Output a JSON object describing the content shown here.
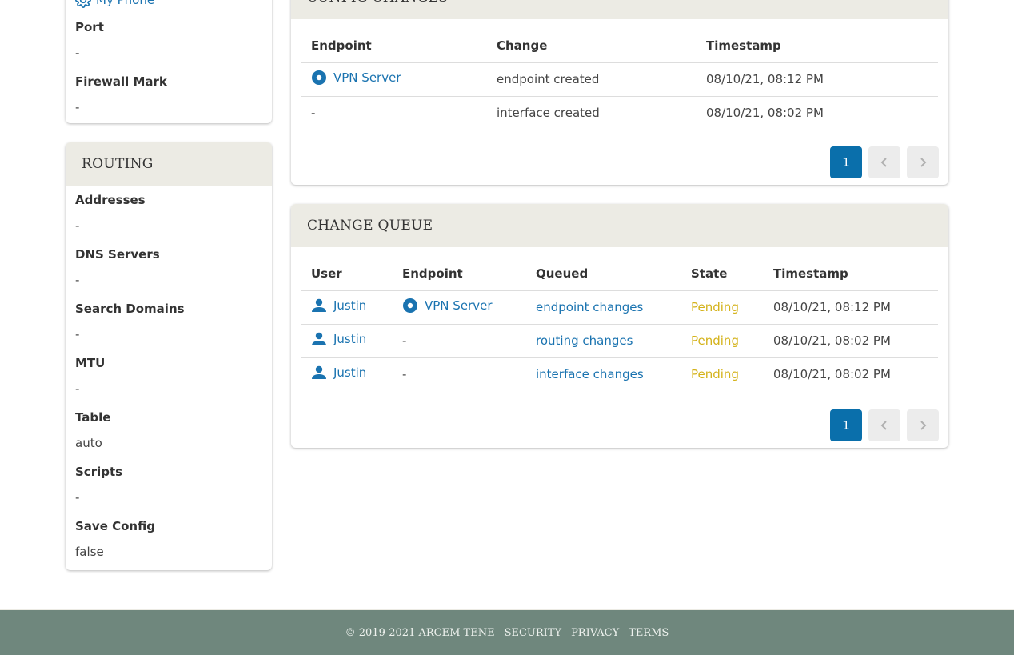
{
  "interface_card": {
    "top_link": {
      "icon": "gear-icon",
      "label": "My Phone"
    },
    "properties": [
      {
        "label": "Port",
        "value": "-"
      },
      {
        "label": "Firewall Mark",
        "value": "-"
      }
    ]
  },
  "routing_card": {
    "title": "ROUTING",
    "properties": [
      {
        "label": "Addresses",
        "value": "-"
      },
      {
        "label": "DNS Servers",
        "value": "-"
      },
      {
        "label": "Search Domains",
        "value": "-"
      },
      {
        "label": "MTU",
        "value": "-"
      },
      {
        "label": "Table",
        "value": "auto"
      },
      {
        "label": "Scripts",
        "value": "-"
      },
      {
        "label": "Save Config",
        "value": "false"
      }
    ]
  },
  "config_changes": {
    "title": "CONFIG CHANGES",
    "columns": [
      "Endpoint",
      "Change",
      "Timestamp"
    ],
    "rows": [
      {
        "endpoint": "VPN Server",
        "endpoint_icon": "endpoint-dot-icon",
        "change": "endpoint created",
        "timestamp": "08/10/21, 08:12 PM"
      },
      {
        "endpoint": "-",
        "change": "interface created",
        "timestamp": "08/10/21, 08:02 PM"
      }
    ],
    "pagination": {
      "current_page": "1",
      "prev_icon": "chevron-left-icon",
      "next_icon": "chevron-right-icon"
    }
  },
  "change_queue": {
    "title": "CHANGE QUEUE",
    "columns": [
      "User",
      "Endpoint",
      "Queued",
      "State",
      "Timestamp"
    ],
    "rows": [
      {
        "user": "Justin",
        "endpoint": "VPN Server",
        "queued": "endpoint changes",
        "state": "Pending",
        "timestamp": "08/10/21, 08:12 PM"
      },
      {
        "user": "Justin",
        "endpoint": "-",
        "queued": "routing changes",
        "state": "Pending",
        "timestamp": "08/10/21, 08:02 PM"
      },
      {
        "user": "Justin",
        "endpoint": "-",
        "queued": "interface changes",
        "state": "Pending",
        "timestamp": "08/10/21, 08:02 PM"
      }
    ],
    "pagination": {
      "current_page": "1"
    }
  },
  "footer": {
    "copyright": "© 2019-2021 ARCEM TENE",
    "links": [
      "SECURITY",
      "PRIVACY",
      "TERMS"
    ]
  },
  "colors": {
    "link": "#1a73b0",
    "pending": "#d4b21a",
    "primary": "#0a6fab",
    "header_bg": "#ecebe4",
    "footer_bg": "#6f877d"
  }
}
